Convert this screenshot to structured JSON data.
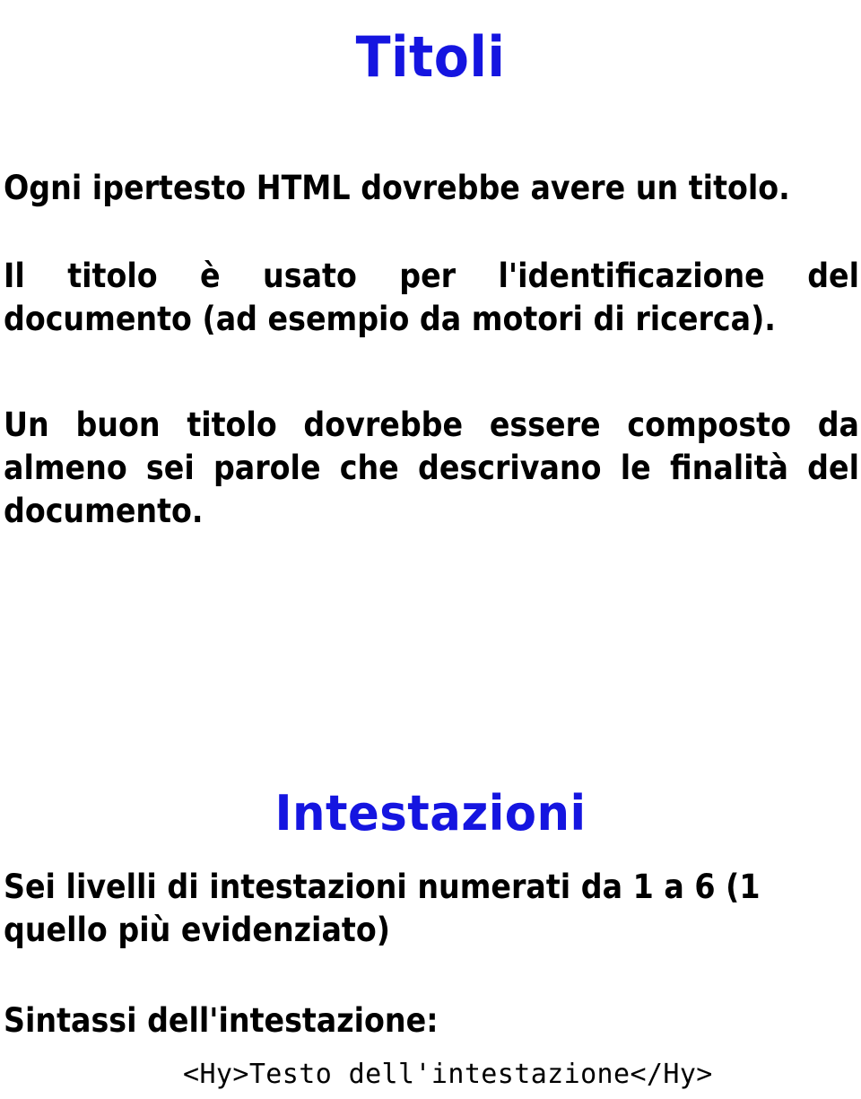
{
  "document": {
    "background_color": "#ffffff",
    "text_color": "#000000",
    "heading_color": "#1515e0",
    "language": "it"
  },
  "headings": {
    "title": "Titoli",
    "section": "Intestazioni"
  },
  "paragraphs": {
    "p1": "Ogni ipertesto HTML dovrebbe avere un titolo.",
    "p2": "Il titolo è usato per l'identificazione del documento (ad esempio da motori di ricerca).",
    "p3": "Un buon titolo dovrebbe essere composto da almeno sei parole che descrivano le finalità del documento.",
    "p4": "Sei livelli di intestazioni numerati da 1 a 6  (1 quello più evidenziato)",
    "p5": "Sintassi dell'intestazione:"
  },
  "code": {
    "syntax_example": "<Hy>Testo dell'intestazione</Hy>"
  }
}
